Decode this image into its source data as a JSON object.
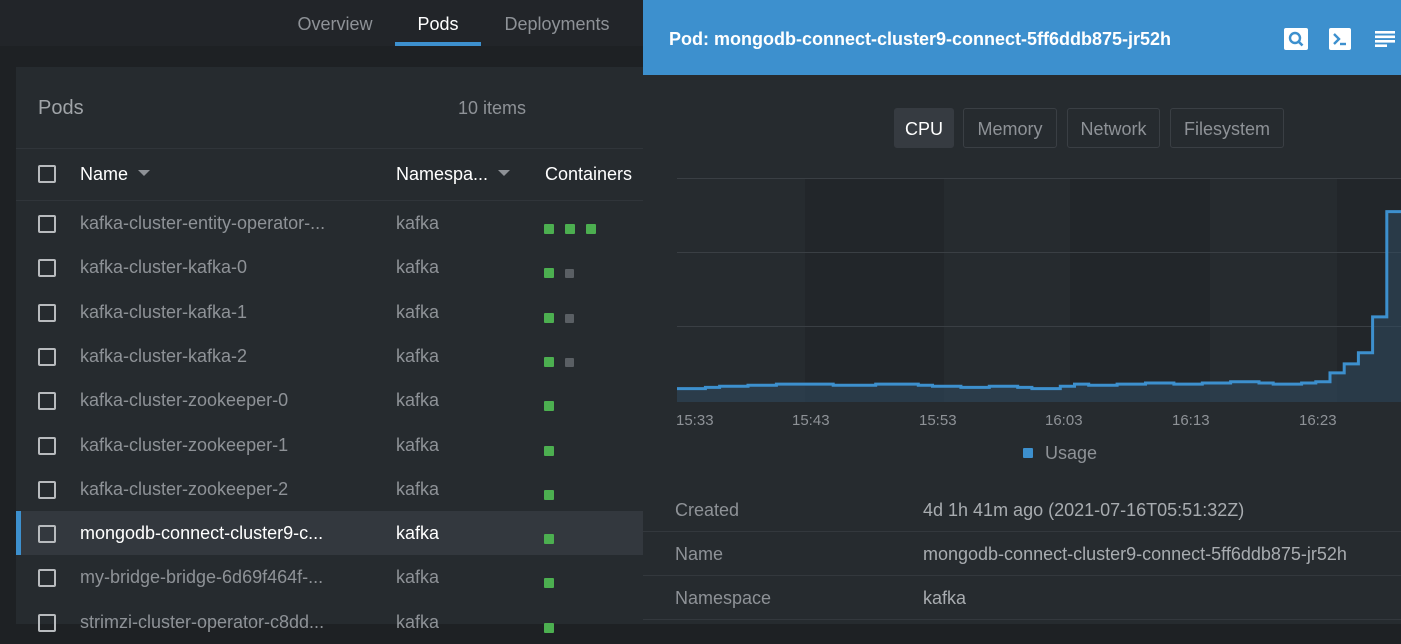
{
  "top_tabs": [
    {
      "label": "Overview"
    },
    {
      "label": "Pods"
    },
    {
      "label": "Deployments"
    }
  ],
  "pods_panel": {
    "title": "Pods",
    "count": "10 items",
    "columns": {
      "name": "Name",
      "namespace": "Namespa...",
      "containers": "Containers"
    }
  },
  "rows": [
    {
      "name": "kafka-cluster-entity-operator-...",
      "namespace": "kafka",
      "containers": [
        "green",
        "green",
        "green"
      ]
    },
    {
      "name": "kafka-cluster-kafka-0",
      "namespace": "kafka",
      "containers": [
        "green",
        "gray"
      ]
    },
    {
      "name": "kafka-cluster-kafka-1",
      "namespace": "kafka",
      "containers": [
        "green",
        "gray"
      ]
    },
    {
      "name": "kafka-cluster-kafka-2",
      "namespace": "kafka",
      "containers": [
        "green",
        "gray"
      ]
    },
    {
      "name": "kafka-cluster-zookeeper-0",
      "namespace": "kafka",
      "containers": [
        "green"
      ]
    },
    {
      "name": "kafka-cluster-zookeeper-1",
      "namespace": "kafka",
      "containers": [
        "green"
      ]
    },
    {
      "name": "kafka-cluster-zookeeper-2",
      "namespace": "kafka",
      "containers": [
        "green"
      ]
    },
    {
      "name": "mongodb-connect-cluster9-c...",
      "namespace": "kafka",
      "containers": [
        "green"
      ],
      "selected": true
    },
    {
      "name": "my-bridge-bridge-6d69f464f-...",
      "namespace": "kafka",
      "containers": [
        "green"
      ]
    },
    {
      "name": "strimzi-cluster-operator-c8dd...",
      "namespace": "kafka",
      "containers": [
        "green"
      ]
    }
  ],
  "drawer": {
    "title": "Pod: mongodb-connect-cluster9-connect-5ff6ddb875-jr52h",
    "icons": [
      "search-icon",
      "terminal-icon",
      "logs-icon"
    ]
  },
  "chart_tabs": [
    {
      "label": "CPU",
      "active": true
    },
    {
      "label": "Memory"
    },
    {
      "label": "Network"
    },
    {
      "label": "Filesystem"
    }
  ],
  "chart_data": {
    "type": "area",
    "x_ticks": [
      "15:33",
      "15:43",
      "15:53",
      "16:03",
      "16:13",
      "16:23"
    ],
    "legend": [
      "Usage"
    ],
    "series": [
      {
        "name": "Usage",
        "color": "#3d90ce",
        "values": [
          0.06,
          0.06,
          0.065,
          0.07,
          0.07,
          0.075,
          0.075,
          0.08,
          0.08,
          0.08,
          0.08,
          0.075,
          0.075,
          0.075,
          0.08,
          0.08,
          0.08,
          0.075,
          0.07,
          0.07,
          0.065,
          0.065,
          0.07,
          0.07,
          0.065,
          0.06,
          0.06,
          0.07,
          0.08,
          0.075,
          0.075,
          0.08,
          0.08,
          0.085,
          0.085,
          0.08,
          0.08,
          0.085,
          0.085,
          0.09,
          0.09,
          0.085,
          0.08,
          0.08,
          0.085,
          0.09,
          0.13,
          0.17,
          0.22,
          0.38,
          0.85
        ]
      }
    ],
    "grid": true
  },
  "details": [
    {
      "key": "Created",
      "value": "4d 1h 41m ago (2021-07-16T05:51:32Z)"
    },
    {
      "key": "Name",
      "value": "mongodb-connect-cluster9-connect-5ff6ddb875-jr52h"
    },
    {
      "key": "Namespace",
      "value": "kafka"
    }
  ]
}
